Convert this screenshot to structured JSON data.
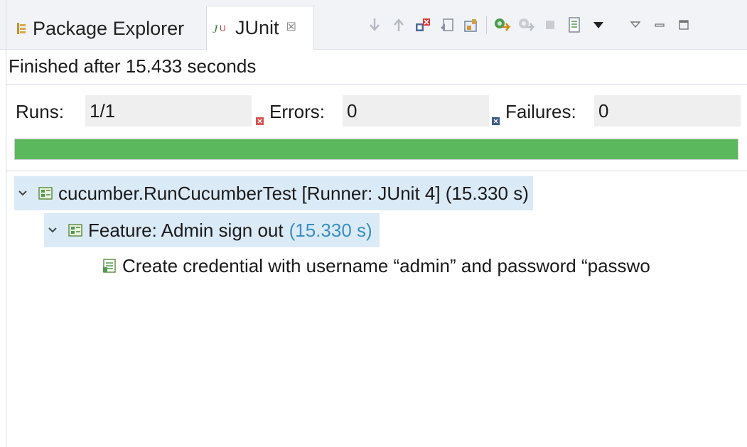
{
  "tabs": {
    "package_explorer": "Package Explorer",
    "junit": "JUnit",
    "close_glyph": "☒"
  },
  "toolbar": {
    "icons": [
      "next-failure-icon",
      "previous-failure-icon",
      "show-failures-only-icon",
      "scroll-lock-icon",
      "show-skipped-icon",
      "rerun-test-icon",
      "rerun-failed-first-icon",
      "stop-icon",
      "test-run-history-icon",
      "history-dropdown-icon",
      "view-menu-icon",
      "minimize-icon",
      "maximize-icon"
    ]
  },
  "status": {
    "message": "Finished after 15.433 seconds"
  },
  "counters": {
    "runs_label": "Runs:",
    "runs_value": "1/1",
    "errors_label": "Errors:",
    "errors_value": "0",
    "failures_label": "Failures:",
    "failures_value": "0"
  },
  "progress": {
    "fraction": 1.0,
    "color": "#5cb85c"
  },
  "tree": {
    "root": {
      "label": "cucumber.RunCucumberTest [Runner: JUnit 4] (15.330 s)",
      "expanded": true
    },
    "feature": {
      "label": "Feature: Admin sign out",
      "time": "(15.330 s)",
      "expanded": true
    },
    "scenario": {
      "label": "Create credential with username “admin” and password “passwo"
    }
  },
  "colors": {
    "tab_bg": "#f1f3f7",
    "selection": "#dbeaf7",
    "time_text": "#3a8fbf",
    "progress_green": "#5cb85c"
  }
}
